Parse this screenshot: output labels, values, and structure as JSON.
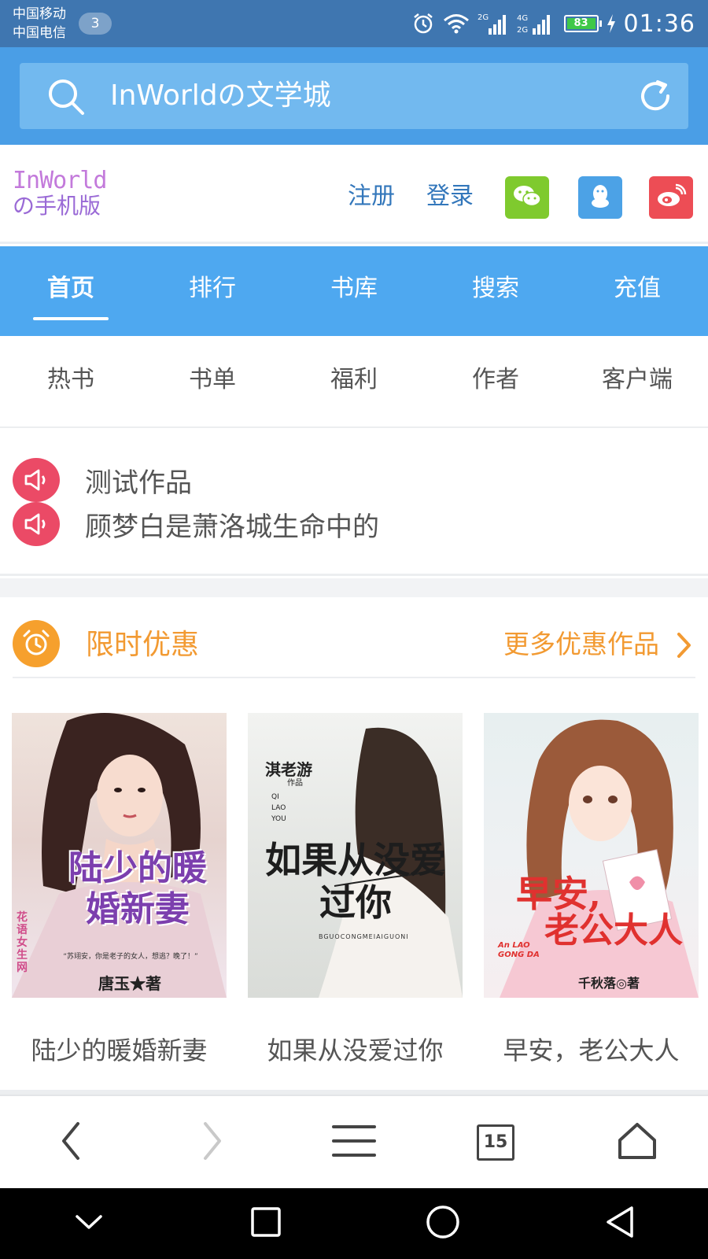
{
  "status_bar": {
    "carrier_1": "中国移动",
    "carrier_2": "中国电信",
    "sim_badge": "3",
    "signal_1_label": "2G",
    "signal_2_label": "4G",
    "signal_3_label": "2G",
    "battery_level": "83",
    "time": "01:36"
  },
  "search_bar": {
    "text": "InWorldの文学城"
  },
  "header": {
    "logo_line1": "InWorld",
    "logo_line2": "の手机版",
    "register": "注册",
    "login": "登录",
    "social_icons": [
      "wechat-icon",
      "qq-icon",
      "weibo-icon"
    ],
    "social_colors": [
      "#7fca2e",
      "#4ca2e6",
      "#ed4d55"
    ]
  },
  "nav_primary": {
    "items": [
      "首页",
      "排行",
      "书库",
      "搜索",
      "充值"
    ],
    "active_index": 0
  },
  "nav_secondary": {
    "items": [
      "热书",
      "书单",
      "福利",
      "作者",
      "客户端"
    ]
  },
  "notices": [
    "测试作品",
    "顾梦白是萧洛城生命中的"
  ],
  "promo": {
    "title": "限时优惠",
    "more": "更多优惠作品",
    "books": [
      {
        "name": "陆少的暖婚新妻",
        "cover_title": "陆少的暖婚新妻",
        "cover_author": "唐玉★著",
        "cover_side": "花语女生网",
        "cover_blurb": "“苏翊安，你是老子的女人，想逃？晚了！”"
      },
      {
        "name": "如果从没爱过你",
        "cover_title": "如果从没爱过你",
        "cover_author": "淇老游",
        "cover_author_sub": "作品",
        "cover_pinyin": "QI LAO YOU",
        "cover_subtitle": "BGUOCONGMEIAIGUONI"
      },
      {
        "name": "早安，老公大人",
        "cover_title_1": "早安,",
        "cover_title_2": "老公大人",
        "cover_pinyin": "An LAO GONG DA",
        "cover_author": "千秋落◎著"
      }
    ]
  },
  "browser_bar": {
    "tab_count": "15"
  }
}
